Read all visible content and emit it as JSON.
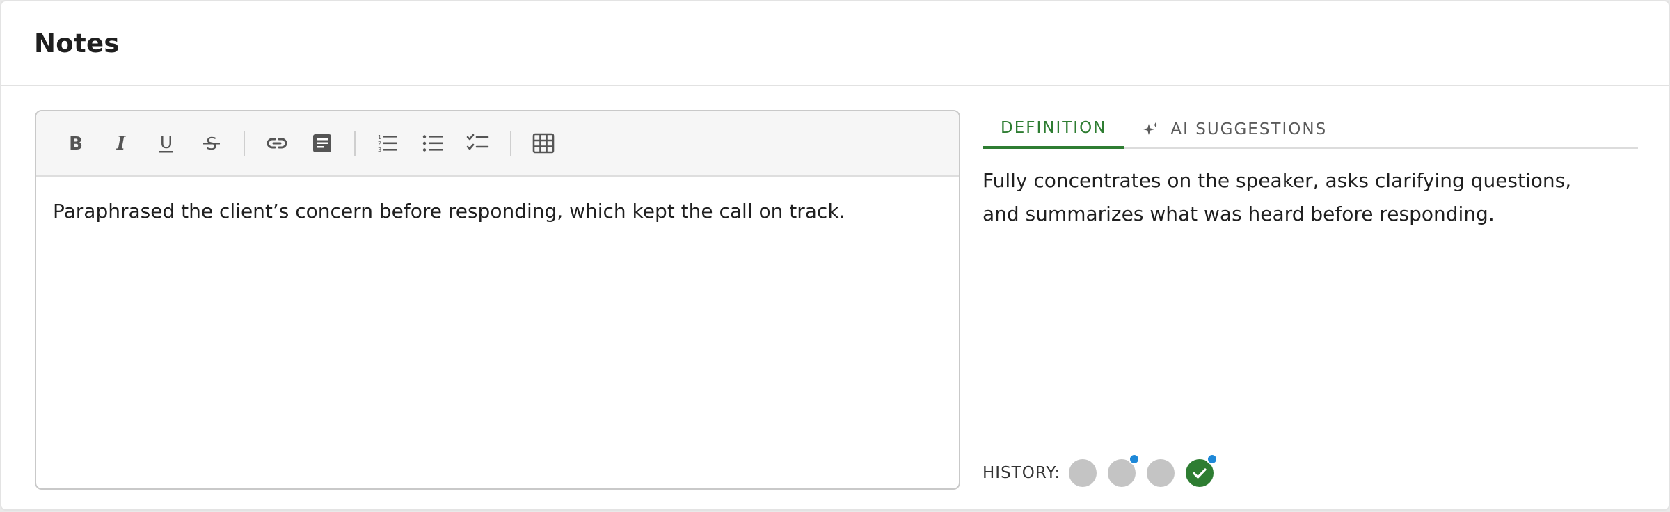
{
  "card": {
    "title": "Notes"
  },
  "editor": {
    "toolbar": {
      "bold": "B",
      "italic": "I",
      "underline": "U",
      "strikethrough": "S"
    },
    "content": "Paraphrased the client’s concern before responding, which kept the call on track."
  },
  "panel": {
    "tabs": [
      {
        "label": "DEFINITION",
        "active": true
      },
      {
        "label": "AI SUGGESTIONS",
        "icon": "sparkle-icon",
        "active": false
      }
    ],
    "definition": "Fully concentrates on the speaker, asks clarifying questions, and summarizes what was heard before responding."
  },
  "history": {
    "label": "HISTORY:",
    "entries": [
      {
        "state": "neutral",
        "badge": false
      },
      {
        "state": "neutral",
        "badge": true
      },
      {
        "state": "neutral",
        "badge": false
      },
      {
        "state": "approved",
        "badge": true
      }
    ]
  },
  "colors": {
    "accent": "#2e7d32",
    "badge": "#1e88d8",
    "neutral_dot": "#c4c4c4"
  }
}
